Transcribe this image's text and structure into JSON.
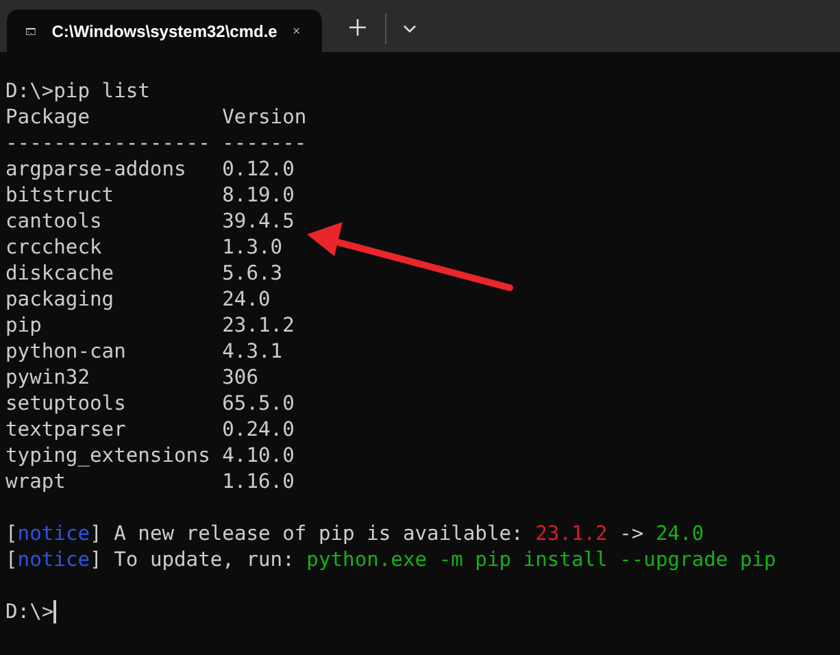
{
  "tab": {
    "title": "C:\\Windows\\system32\\cmd.e",
    "selected": true
  },
  "lines": [
    {
      "kind": "blank"
    },
    {
      "kind": "text",
      "segments": [
        {
          "kind": "plain",
          "text": "D:\\>pip list"
        }
      ]
    },
    {
      "kind": "text",
      "segments": [
        {
          "kind": "plain",
          "text": "Package           Version"
        }
      ]
    },
    {
      "kind": "text",
      "segments": [
        {
          "kind": "plain",
          "text": "----------------- -------"
        }
      ]
    },
    {
      "kind": "text",
      "segments": [
        {
          "kind": "plain",
          "text": "argparse-addons   0.12.0"
        }
      ]
    },
    {
      "kind": "text",
      "segments": [
        {
          "kind": "plain",
          "text": "bitstruct         8.19.0"
        }
      ]
    },
    {
      "kind": "text",
      "segments": [
        {
          "kind": "plain",
          "text": "cantools          39.4.5"
        }
      ]
    },
    {
      "kind": "text",
      "segments": [
        {
          "kind": "plain",
          "text": "crccheck          1.3.0"
        }
      ]
    },
    {
      "kind": "text",
      "segments": [
        {
          "kind": "plain",
          "text": "diskcache         5.6.3"
        }
      ]
    },
    {
      "kind": "text",
      "segments": [
        {
          "kind": "plain",
          "text": "packaging         24.0"
        }
      ]
    },
    {
      "kind": "text",
      "segments": [
        {
          "kind": "plain",
          "text": "pip               23.1.2"
        }
      ]
    },
    {
      "kind": "text",
      "segments": [
        {
          "kind": "plain",
          "text": "python-can        4.3.1"
        }
      ]
    },
    {
      "kind": "text",
      "segments": [
        {
          "kind": "plain",
          "text": "pywin32           306"
        }
      ]
    },
    {
      "kind": "text",
      "segments": [
        {
          "kind": "plain",
          "text": "setuptools        65.5.0"
        }
      ]
    },
    {
      "kind": "text",
      "segments": [
        {
          "kind": "plain",
          "text": "textparser        0.24.0"
        }
      ]
    },
    {
      "kind": "text",
      "segments": [
        {
          "kind": "plain",
          "text": "typing_extensions 4.10.0"
        }
      ]
    },
    {
      "kind": "text",
      "segments": [
        {
          "kind": "plain",
          "text": "wrapt             1.16.0"
        }
      ]
    },
    {
      "kind": "blank"
    },
    {
      "kind": "text",
      "segments": [
        {
          "kind": "plain",
          "text": "["
        },
        {
          "kind": "blue",
          "text": "notice"
        },
        {
          "kind": "plain",
          "text": "] A new release of pip is available: "
        },
        {
          "kind": "red",
          "text": "23.1.2"
        },
        {
          "kind": "plain",
          "text": " -> "
        },
        {
          "kind": "green",
          "text": "24.0"
        }
      ]
    },
    {
      "kind": "text",
      "segments": [
        {
          "kind": "plain",
          "text": "["
        },
        {
          "kind": "blue",
          "text": "notice"
        },
        {
          "kind": "plain",
          "text": "] To update, run: "
        },
        {
          "kind": "green",
          "text": "python.exe -m pip install --upgrade pip"
        }
      ]
    },
    {
      "kind": "blank"
    },
    {
      "kind": "prompt",
      "segments": [
        {
          "kind": "plain",
          "text": "D:\\>"
        }
      ]
    }
  ]
}
